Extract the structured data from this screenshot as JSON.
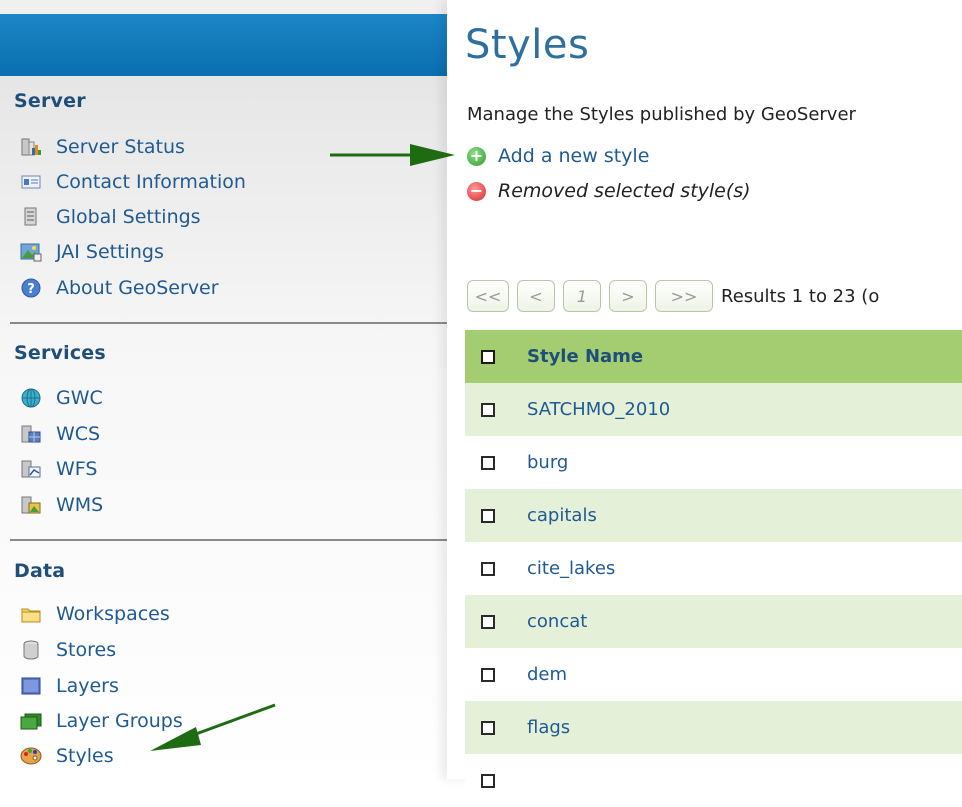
{
  "sidebar": {
    "sections": {
      "server": {
        "title": "Server",
        "items": [
          {
            "label": "Server Status",
            "icon": "server-status-icon"
          },
          {
            "label": "Contact Information",
            "icon": "contact-card-icon"
          },
          {
            "label": "Global Settings",
            "icon": "settings-document-icon"
          },
          {
            "label": "JAI Settings",
            "icon": "image-settings-icon"
          },
          {
            "label": "About GeoServer",
            "icon": "help-icon"
          }
        ]
      },
      "services": {
        "title": "Services",
        "items": [
          {
            "label": "GWC",
            "icon": "globe-icon"
          },
          {
            "label": "WCS",
            "icon": "wcs-service-icon"
          },
          {
            "label": "WFS",
            "icon": "wfs-service-icon"
          },
          {
            "label": "WMS",
            "icon": "wms-service-icon"
          }
        ]
      },
      "data": {
        "title": "Data",
        "items": [
          {
            "label": "Workspaces",
            "icon": "folder-icon"
          },
          {
            "label": "Stores",
            "icon": "database-icon"
          },
          {
            "label": "Layers",
            "icon": "layer-icon"
          },
          {
            "label": "Layer Groups",
            "icon": "layer-group-icon"
          },
          {
            "label": "Styles",
            "icon": "palette-icon"
          }
        ]
      }
    }
  },
  "main": {
    "title": "Styles",
    "description": "Manage the Styles published by GeoServer",
    "actions": {
      "add": "Add a new style",
      "remove": "Removed selected style(s)"
    },
    "pager": {
      "first": "<<",
      "prev": "<",
      "page": "1",
      "next": ">",
      "last": ">>",
      "results": "Results 1 to 23 (o"
    },
    "table": {
      "header": "Style Name",
      "rows": [
        "SATCHMO_2010",
        "burg",
        "capitals",
        "cite_lakes",
        "concat",
        "dem",
        "flags"
      ]
    }
  },
  "colors": {
    "header_blue": "#0a6fae",
    "table_header_green": "#a4cd72",
    "row_alt_green": "#e5f0d9",
    "arrow_green": "#1f6b12"
  }
}
